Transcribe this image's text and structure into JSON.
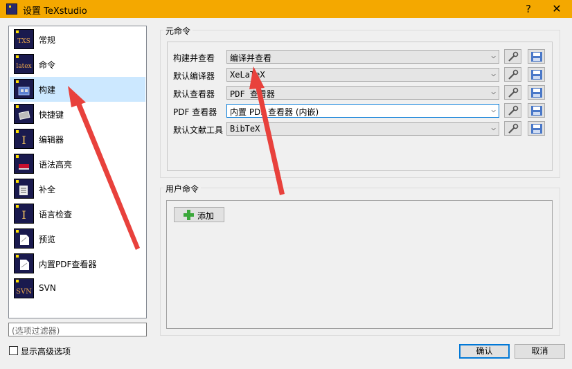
{
  "window": {
    "title": "设置 TeXstudio",
    "help_glyph": "?",
    "close_glyph": "✕"
  },
  "sidebar": {
    "items": [
      {
        "label": "常规",
        "icon": "general-icon",
        "mark": "TXS"
      },
      {
        "label": "命令",
        "icon": "commands-icon",
        "mark": "latex"
      },
      {
        "label": "构建",
        "icon": "build-icon",
        "mark": "",
        "selected": true
      },
      {
        "label": "快捷键",
        "icon": "shortcuts-icon",
        "mark": ""
      },
      {
        "label": "编辑器",
        "icon": "editor-icon",
        "mark": "I"
      },
      {
        "label": "语法高亮",
        "icon": "syntax-highlight-icon",
        "mark": ""
      },
      {
        "label": "补全",
        "icon": "completion-icon",
        "mark": ""
      },
      {
        "label": "语言检查",
        "icon": "language-check-icon",
        "mark": "I"
      },
      {
        "label": "预览",
        "icon": "preview-icon",
        "mark": ""
      },
      {
        "label": "内置PDF查看器",
        "icon": "pdf-viewer-icon",
        "mark": ""
      },
      {
        "label": "SVN",
        "icon": "svn-icon",
        "mark": "SVN"
      }
    ],
    "filter_placeholder": "(选项过滤器)",
    "advanced_label": "显示高级选项",
    "advanced_checked": false
  },
  "meta_commands": {
    "title": "元命令",
    "rows": [
      {
        "label": "构建并查看",
        "value": "编译并查看"
      },
      {
        "label": "默认编译器",
        "value": "XeLaTeX"
      },
      {
        "label": "默认查看器",
        "value": "PDF 查看器"
      },
      {
        "label": "PDF 查看器",
        "value": "内置 PDF 查看器 (内嵌)"
      },
      {
        "label": "默认文献工具",
        "value": "BibTeX"
      }
    ]
  },
  "user_commands": {
    "title": "用户命令",
    "add_label": "添加"
  },
  "buttons": {
    "ok": "确认",
    "cancel": "取消"
  },
  "colors": {
    "titlebar": "#f4a800",
    "selection": "#cce8ff",
    "annotation_arrow": "#e8413c",
    "focus": "#0078d7"
  }
}
